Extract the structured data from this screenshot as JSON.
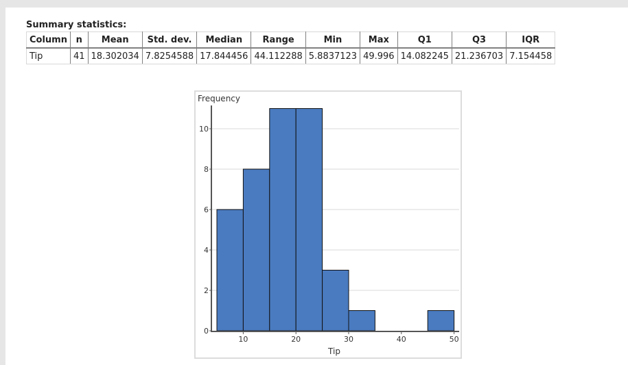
{
  "page": {
    "stats_title": "Summary statistics:"
  },
  "stats_table": {
    "headers": [
      "Column",
      "n",
      "Mean",
      "Std. dev.",
      "Median",
      "Range",
      "Min",
      "Max",
      "Q1",
      "Q3",
      "IQR"
    ],
    "rows": [
      [
        "Tip",
        "41",
        "18.302034",
        "7.8254588",
        "17.844456",
        "44.112288",
        "5.8837123",
        "49.996",
        "14.082245",
        "21.236703",
        "7.154458"
      ]
    ]
  },
  "colors": {
    "bar_fill": "#4a7bc0",
    "bar_stroke": "#111111",
    "gridline": "#ececec",
    "axis": "#555555"
  },
  "chart_data": {
    "type": "bar",
    "subtype": "histogram",
    "title": "",
    "xlabel": "Tip",
    "ylabel": "Frequency",
    "bin_width": 5,
    "bins": [
      {
        "start": 5,
        "end": 10,
        "count": 6
      },
      {
        "start": 10,
        "end": 15,
        "count": 8
      },
      {
        "start": 15,
        "end": 20,
        "count": 11
      },
      {
        "start": 20,
        "end": 25,
        "count": 11
      },
      {
        "start": 25,
        "end": 30,
        "count": 3
      },
      {
        "start": 30,
        "end": 35,
        "count": 1
      },
      {
        "start": 35,
        "end": 40,
        "count": 0
      },
      {
        "start": 40,
        "end": 45,
        "count": 0
      },
      {
        "start": 45,
        "end": 50,
        "count": 1
      }
    ],
    "xlim": [
      4,
      51
    ],
    "ylim": [
      0,
      11.5
    ],
    "x_ticks": [
      10,
      20,
      30,
      40,
      50
    ],
    "y_ticks": [
      0,
      2,
      4,
      6,
      8,
      10
    ],
    "grid": "horizontal",
    "legend": "none"
  }
}
